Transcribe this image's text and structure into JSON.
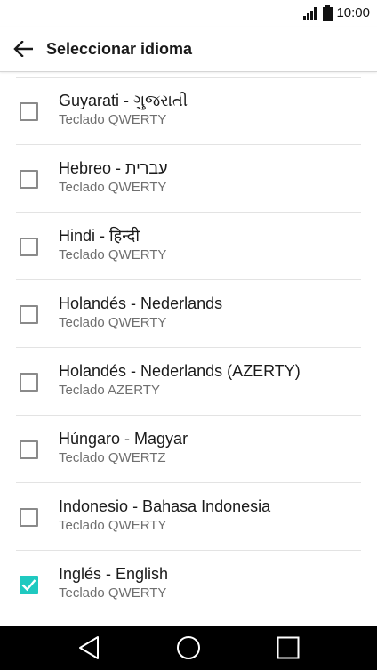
{
  "status_bar": {
    "time": "10:00",
    "icons": [
      "signal-icon",
      "battery-icon"
    ]
  },
  "header": {
    "title": "Seleccionar idioma",
    "back_icon": "arrow-left-icon"
  },
  "languages": [
    {
      "title": "Guyarati - ગુજરાતી",
      "subtitle": "Teclado QWERTY",
      "checked": false
    },
    {
      "title": "Hebreo - עברית",
      "subtitle": "Teclado QWERTY",
      "checked": false
    },
    {
      "title": "Hindi - हिन्दी",
      "subtitle": "Teclado QWERTY",
      "checked": false
    },
    {
      "title": "Holandés - Nederlands",
      "subtitle": "Teclado QWERTY",
      "checked": false
    },
    {
      "title": "Holandés - Nederlands (AZERTY)",
      "subtitle": "Teclado AZERTY",
      "checked": false
    },
    {
      "title": "Húngaro - Magyar",
      "subtitle": "Teclado QWERTZ",
      "checked": false
    },
    {
      "title": "Indonesio - Bahasa Indonesia",
      "subtitle": "Teclado QWERTY",
      "checked": false
    },
    {
      "title": "Inglés - English",
      "subtitle": "Teclado QWERTY",
      "checked": true
    }
  ],
  "nav_bar": {
    "buttons": [
      "back-triangle-icon",
      "home-circle-icon",
      "recents-square-icon"
    ]
  },
  "colors": {
    "accent": "#1fc9c0",
    "checkbox_border": "#8a8a8a",
    "subtitle": "#6f6f6f",
    "nav_background": "#000000"
  }
}
